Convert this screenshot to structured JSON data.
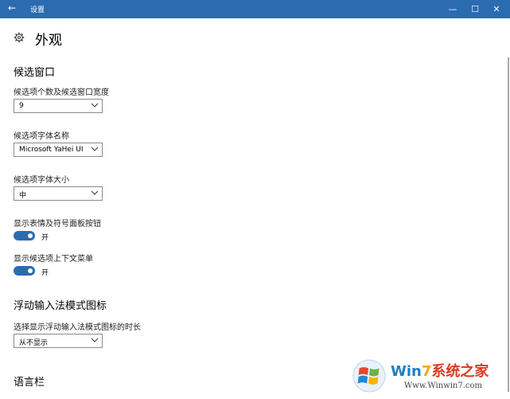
{
  "window": {
    "title": "设置",
    "back_glyph": "←",
    "min_glyph": "—",
    "max_glyph": "☐",
    "close_glyph": "✕",
    "accent": "#2b6cb0"
  },
  "page": {
    "title": "外观",
    "icon": "gear-icon"
  },
  "candidates": {
    "heading": "候选窗口",
    "count_label": "候选项个数及候选窗口宽度",
    "count_value": "9",
    "font_label": "候选项字体名称",
    "font_value": "Microsoft YaHei UI",
    "size_label": "候选项字体大小",
    "size_value": "中",
    "emoji_label": "显示表情及符号面板按钮",
    "emoji_state": "开",
    "emoji_on": true,
    "context_label": "显示候选项上下文菜单",
    "context_state": "开",
    "context_on": true
  },
  "floating": {
    "heading": "浮动输入法模式图标",
    "duration_label": "选择显示浮动输入法模式图标的时长",
    "duration_value": "从不显示"
  },
  "langbar": {
    "heading": "语言栏"
  },
  "watermark": {
    "brand_w": "Win",
    "brand_num": "7",
    "brand_cn": "系统之家",
    "url": "Www.Winwin7.com"
  }
}
